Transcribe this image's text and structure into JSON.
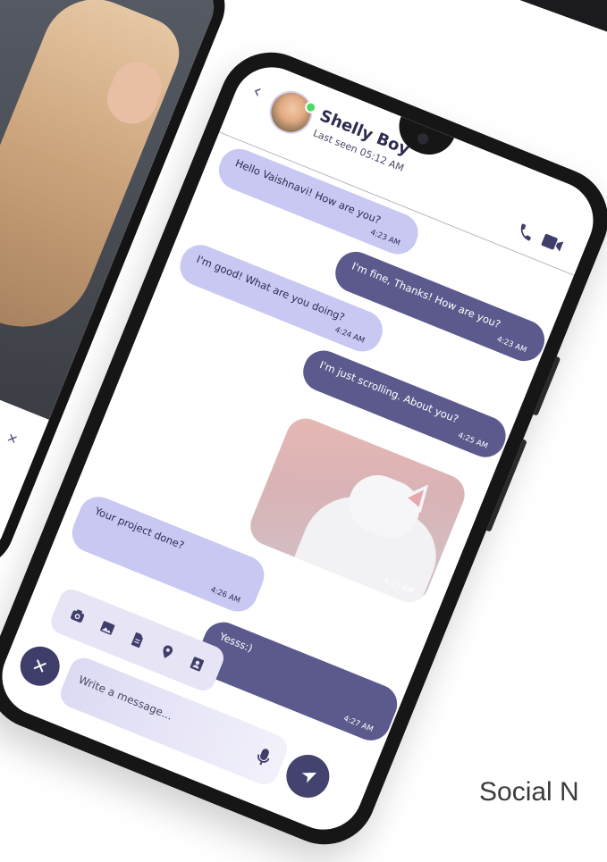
{
  "contact": {
    "name": "Shelly Boy",
    "status": "Last seen 05:12 AM"
  },
  "messages": [
    {
      "text": "Hello Vaishnavi! How are you?",
      "time": "4:23 AM",
      "direction": "incoming"
    },
    {
      "text": "I'm fine, Thanks! How are you?",
      "time": "4:23 AM",
      "direction": "outgoing"
    },
    {
      "text": "I'm good! What are you doing?",
      "time": "4:24 AM",
      "direction": "incoming"
    },
    {
      "text": "I'm just scrolling. About you?",
      "time": "4:25 AM",
      "direction": "outgoing"
    },
    {
      "text": "",
      "time": "4:25 AM",
      "direction": "outgoing",
      "image": "white-cat-photo"
    },
    {
      "text": "Your project done?",
      "time": "4:26 AM",
      "direction": "incoming"
    },
    {
      "text": "Yesss:)",
      "time": "4:27 AM",
      "direction": "outgoing"
    }
  ],
  "composer": {
    "placeholder": "Write a message..."
  },
  "attachments": [
    "camera-icon",
    "gallery-icon",
    "document-icon",
    "location-icon",
    "contact-icon"
  ],
  "caption": "Social N",
  "colors": {
    "incoming_bubble": "#c9c8f2",
    "outgoing_bubble": "#5c5a8d",
    "accent": "#44436f"
  }
}
